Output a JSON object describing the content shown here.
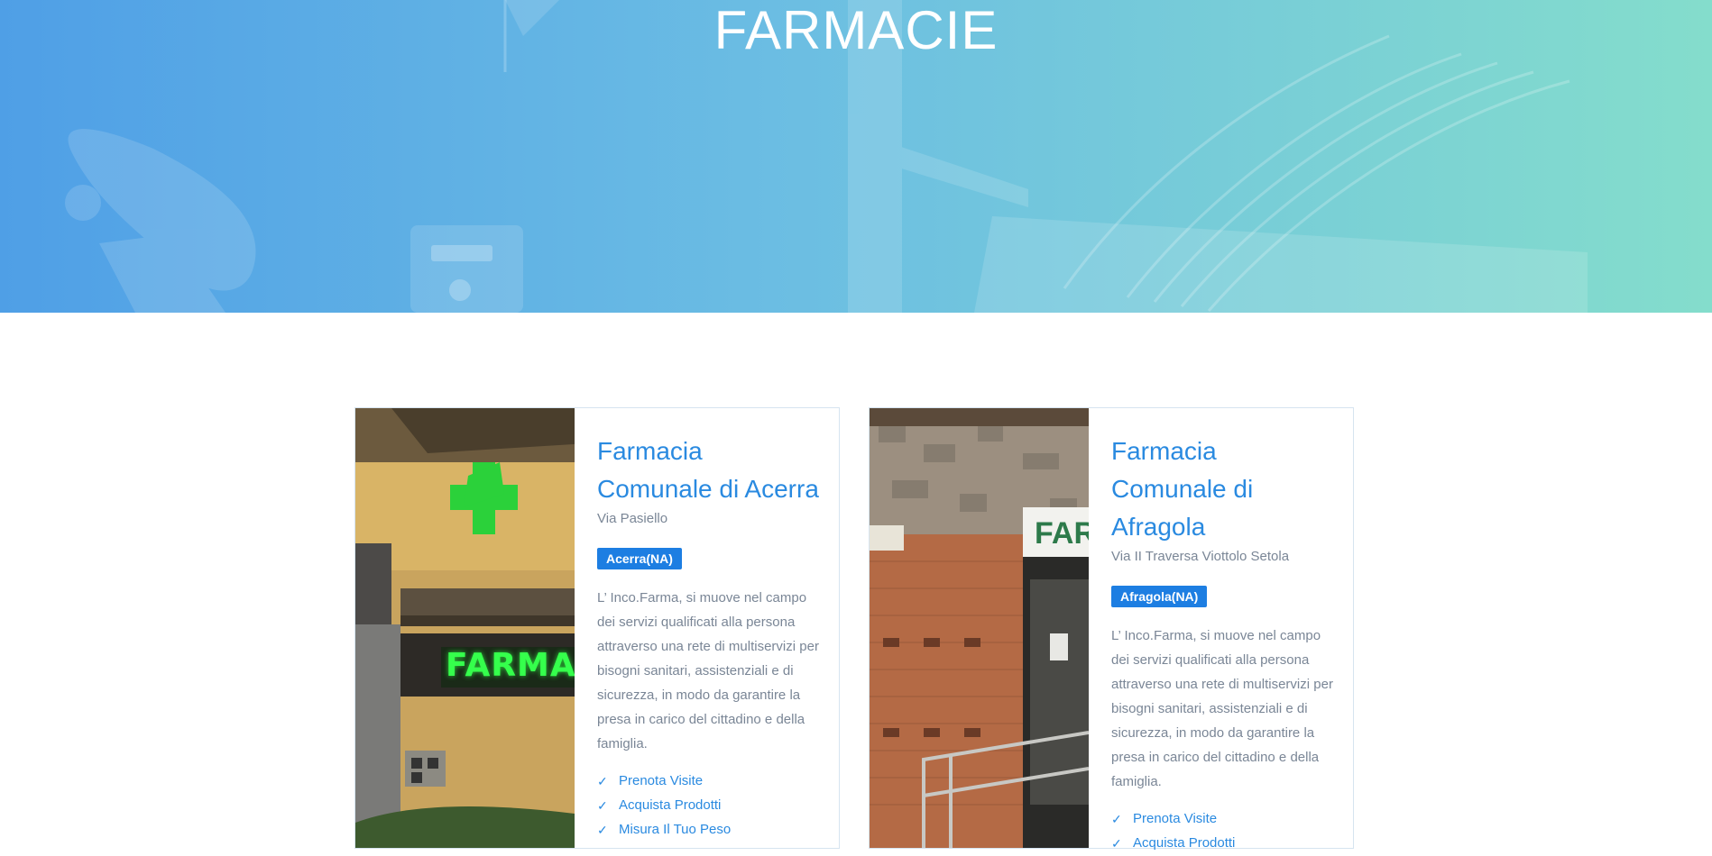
{
  "hero": {
    "title": "FARMACIE"
  },
  "pharmacies": [
    {
      "name": "Farmacia Comunale di Acerra",
      "address": "Via Pasiello",
      "city": "Acerra(NA)",
      "description": "L’ Inco.Farma, si muove nel campo dei servizi qualificati alla persona attraverso una rete di multiservizi per bisogni sanitari, assistenziali e di sicurezza, in modo da garantire la presa in carico del cittadino e della famiglia.",
      "features": [
        "Prenota Visite",
        "Acquista Prodotti",
        "Misura Il Tuo Peso"
      ]
    },
    {
      "name": "Farmacia Comunale di Afragola",
      "address": "Via II Traversa Viottolo Setola",
      "city": "Afragola(NA)",
      "description": "L’ Inco.Farma, si muove nel campo dei servizi qualificati alla persona attraverso una rete di multiservizi per bisogni sanitari, assistenziali e di sicurezza, in modo da garantire la presa in carico del cittadino e della famiglia.",
      "features": [
        "Prenota Visite",
        "Acquista Prodotti"
      ]
    }
  ],
  "check_icon": "check-icon",
  "colors": {
    "accent": "#2a8ae0",
    "badge": "#1d7ee2",
    "hero_start": "#4f9fe6",
    "hero_end": "#84ddcc"
  }
}
